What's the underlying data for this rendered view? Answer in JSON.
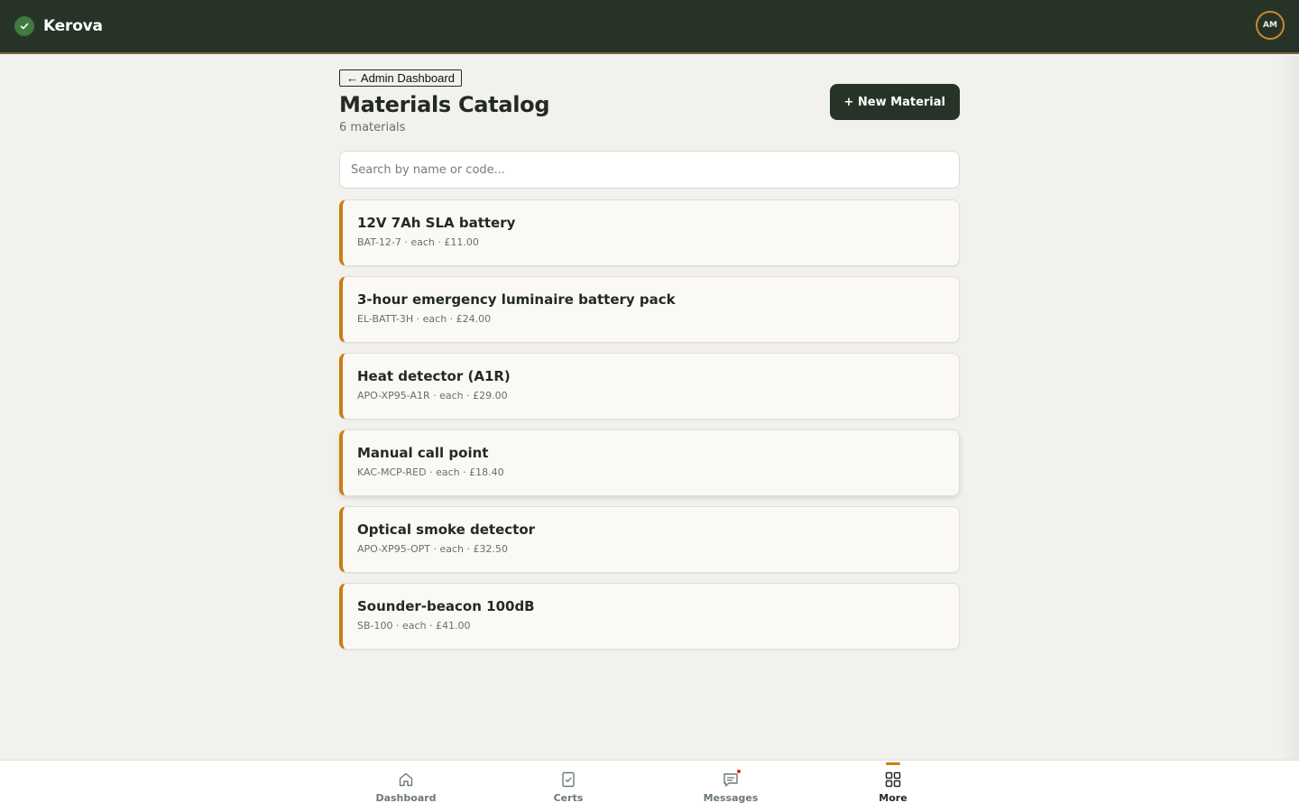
{
  "app": {
    "brand_name": "Kerova",
    "avatar_initials": "AM"
  },
  "header": {
    "back_label": "← Admin Dashboard",
    "title": "Materials Catalog",
    "count_label": "6 materials",
    "new_button_label": "+ New Material"
  },
  "search": {
    "placeholder": "Search by name or code...",
    "value": ""
  },
  "materials": [
    {
      "name": "12V 7Ah SLA battery",
      "meta": "BAT-12-7 · each · £11.00"
    },
    {
      "name": "3-hour emergency luminaire battery pack",
      "meta": "EL-BATT-3H · each · £24.00"
    },
    {
      "name": "Heat detector (A1R)",
      "meta": "APO-XP95-A1R · each · £29.00"
    },
    {
      "name": "Manual call point",
      "meta": "KAC-MCP-RED · each · £18.40"
    },
    {
      "name": "Optical smoke detector",
      "meta": "APO-XP95-OPT · each · £32.50"
    },
    {
      "name": "Sounder-beacon 100dB",
      "meta": "SB-100 · each · £41.00"
    }
  ],
  "bottom_nav": {
    "items": [
      {
        "label": "Dashboard",
        "icon": "home-icon"
      },
      {
        "label": "Certs",
        "icon": "certificate-icon"
      },
      {
        "label": "Messages",
        "icon": "message-icon",
        "has_notification": true
      },
      {
        "label": "More",
        "icon": "grid-icon",
        "active": true
      }
    ]
  },
  "colors": {
    "topbar": "#283328",
    "accent": "#c97e14",
    "background": "#f2f1ed",
    "notification": "#d9262a"
  }
}
